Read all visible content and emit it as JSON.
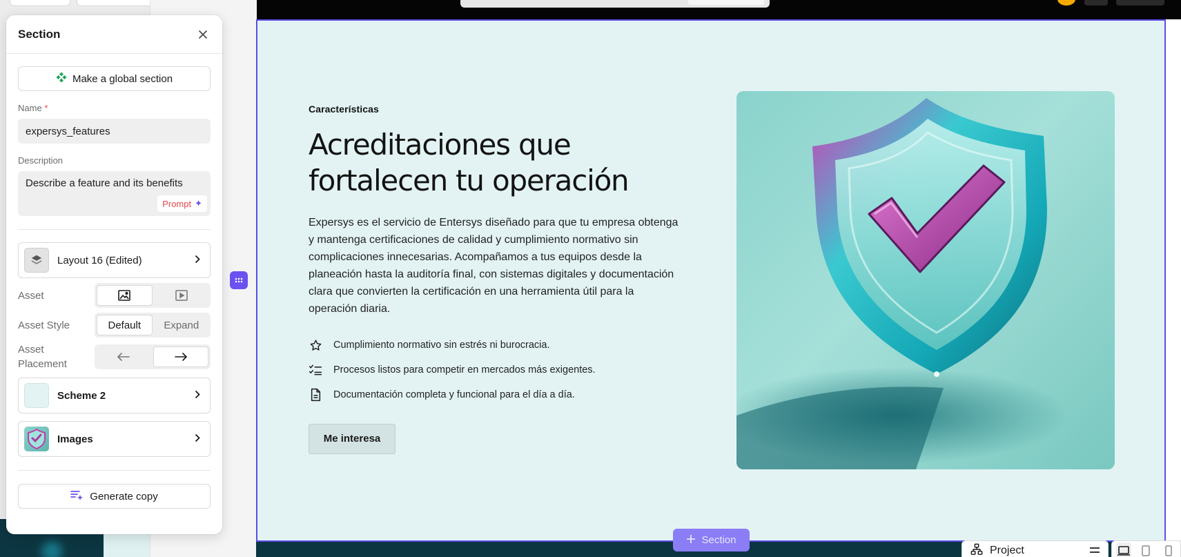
{
  "panel": {
    "title": "Section",
    "global_button": "Make a global section",
    "name_label": "Name",
    "name_required": "*",
    "name_value": "expersys_features",
    "description_label": "Description",
    "description_placeholder": "Describe a feature and its benefits",
    "prompt_button": "Prompt",
    "layout_label": "Layout 16 (Edited)",
    "asset_label": "Asset",
    "asset_options": [
      "image-icon",
      "video-icon"
    ],
    "asset_selected": "image",
    "asset_style_label": "Asset Style",
    "asset_style_options": [
      "Default",
      "Expand"
    ],
    "asset_style_selected": "Default",
    "asset_placement_label": "Asset Placement",
    "asset_placement_options": [
      "arrow-left-icon",
      "arrow-right-icon"
    ],
    "asset_placement_selected": "right",
    "scheme_label": "Scheme 2",
    "images_label": "Images",
    "generate_copy": "Generate copy"
  },
  "section": {
    "eyebrow": "Características",
    "headline": "Acreditaciones que fortalecen tu operación",
    "body": "Expersys es el servicio de Entersys diseñado para que tu empresa obtenga y mantenga certificaciones de calidad y cumplimiento normativo sin complicaciones innecesarias. Acompañamos a tus equipos desde la planeación hasta la auditoría final, con sistemas digitales y documentación clara que convierten la certificación en una herramienta útil para la operación diaria.",
    "features": [
      {
        "icon": "star-icon",
        "text": "Cumplimiento normativo sin estrés ni burocracia."
      },
      {
        "icon": "checklist-icon",
        "text": "Procesos listos para competir en mercados más exigentes."
      },
      {
        "icon": "document-icon",
        "text": "Documentación completa y funcional para el día a día."
      }
    ],
    "cta": "Me interesa",
    "image": "shield-checkmark-image"
  },
  "canvas": {
    "add_section": "Section"
  },
  "bottom_bar": {
    "project_label": "Project"
  },
  "colors": {
    "accent": "#6b52f0",
    "section_bg": "#e3f3f3",
    "selection_border": "#5b4ce6"
  }
}
